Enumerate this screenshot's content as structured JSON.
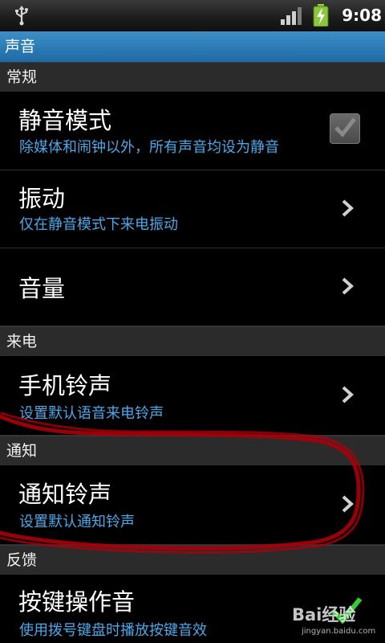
{
  "status_bar": {
    "time": "9:08",
    "icons": [
      "usb-icon",
      "signal-icon",
      "battery-charging-icon"
    ]
  },
  "title_bar": {
    "title": "声音"
  },
  "sections": {
    "general": {
      "label": "常规"
    },
    "incoming": {
      "label": "来电"
    },
    "notification": {
      "label": "通知"
    },
    "feedback": {
      "label": "反馈"
    }
  },
  "rows": {
    "silent_mode": {
      "title": "静音模式",
      "summary": "除媒体和闹钟以外，所有声音均设为静音",
      "checked": true
    },
    "vibrate": {
      "title": "振动",
      "summary": "仅在静音模式下来电振动"
    },
    "volume": {
      "title": "音量"
    },
    "phone_ringtone": {
      "title": "手机铃声",
      "summary": "设置默认语音来电铃声"
    },
    "notification_ringtone": {
      "title": "通知铃声",
      "summary": "设置默认通知铃声"
    },
    "dial_tones": {
      "title": "按键操作音",
      "summary": "使用拨号键盘时播放按键音效",
      "checked": true
    }
  },
  "watermark": {
    "brand": "Bai经验",
    "url": "jingyan.baidu.com"
  },
  "colors": {
    "title_bar": "#2a7bbb",
    "summary_text": "#4aa8e8",
    "section_bg": "#2b2b2b",
    "annotation": "#b0000a",
    "check_green": "#33cc33"
  }
}
